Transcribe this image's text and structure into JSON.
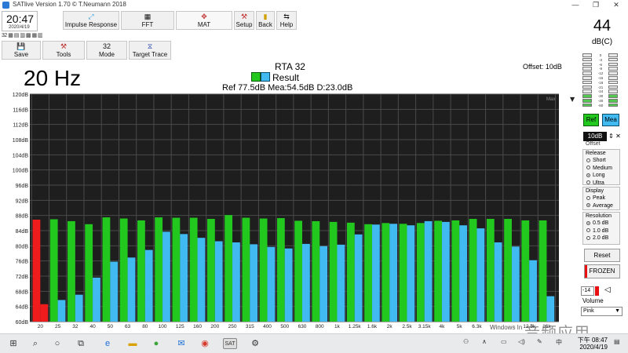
{
  "window": {
    "title": "SATlive Version 1.70 © T.Neumann 2018",
    "minimize": "—",
    "maximize": "❐",
    "close": "✕"
  },
  "clock": {
    "time": "20:47",
    "date": "2020/4/19"
  },
  "mini_icons": "32 ▦ ▤ ▥ ▩ ▦ ▥",
  "toolbar": {
    "impulse": "Impulse Response",
    "fft": "FFT",
    "mat": "MAT",
    "setup": "Setup",
    "back": "Back",
    "help": "Help",
    "save": "Save",
    "tools": "Tools",
    "mode": "Mode",
    "mode_icon": "32",
    "target_trace": "Target Trace"
  },
  "display": {
    "frequency": "20 Hz",
    "rta_title": "RTA 32",
    "legend": "Result",
    "stats": "Ref 77.5dB Mea:54.5dB D:23.0dB",
    "offset_label": "Offset: 10dB",
    "max_tag": "Max"
  },
  "side": {
    "spl_value": "44",
    "spl_unit": "dB(C)",
    "meter_scale": [
      "0",
      "-3",
      "-6",
      "-9",
      "-12",
      "-15",
      "-18",
      "-21",
      "-24",
      "-30",
      "-40",
      "-60"
    ],
    "ref_label": "Ref",
    "mea_label": "Mea",
    "offset_value": "10dB",
    "offset_caption": "Offset",
    "release": {
      "title": "Release",
      "options": [
        "Short",
        "Medium",
        "Long",
        "Ultra"
      ],
      "selected": 2
    },
    "display_group": {
      "title": "Display",
      "options": [
        "Peak",
        "Average"
      ],
      "selected": 1
    },
    "resolution": {
      "title": "Resolution",
      "options": [
        "0.5 dB",
        "1.0 dB",
        "2.0 dB"
      ],
      "selected": 0
    },
    "reset": "Reset",
    "frozen": "FROZEN",
    "volume_value": "-14",
    "volume_label": "Volume",
    "noise_type": "Pink"
  },
  "chart_data": {
    "type": "bar",
    "title": "RTA 32",
    "xlabel": "",
    "ylabel": "",
    "ylim": [
      60,
      120
    ],
    "y_ticks": [
      "60dB",
      "64dB",
      "68dB",
      "72dB",
      "76dB",
      "80dB",
      "84dB",
      "88dB",
      "92dB",
      "96dB",
      "100dB",
      "104dB",
      "108dB",
      "112dB",
      "116dB",
      "120dB"
    ],
    "categories": [
      "20",
      "25",
      "32",
      "40",
      "50",
      "63",
      "80",
      "100",
      "125",
      "160",
      "200",
      "250",
      "315",
      "400",
      "500",
      "630",
      "800",
      "1k",
      "1.25k",
      "1.6k",
      "2k",
      "2.5k",
      "3.15k",
      "4k",
      "5k",
      "6.3k",
      "8k",
      "10k",
      "12.5k",
      "16k"
    ],
    "grid": true,
    "colors": {
      "ref": "#22c81e",
      "mea": "#41baf2",
      "highlight": "#ee1c1c",
      "background": "#1e1e1e",
      "grid": "#4a4a4a"
    },
    "highlight_index": 0,
    "series": [
      {
        "name": "Ref",
        "values": [
          86.9,
          87,
          86.5,
          85.7,
          87.5,
          87.2,
          86.7,
          87.5,
          87.4,
          87.4,
          87.1,
          88.1,
          87.4,
          87.2,
          87.3,
          86.6,
          86.5,
          86.3,
          86.1,
          85.7,
          86,
          85.8,
          86,
          86.6,
          86.7,
          87.1,
          87.1,
          87.1,
          86.7,
          86.7
        ]
      },
      {
        "name": "Mea",
        "values": [
          64.6,
          65.7,
          67.1,
          71.6,
          75.8,
          76.9,
          78.9,
          83.7,
          83.1,
          82.1,
          81.2,
          80.9,
          80.4,
          79.7,
          79.3,
          80.5,
          79.9,
          80.3,
          83,
          85.6,
          85.8,
          85.4,
          86.5,
          86.3,
          85.4,
          84.6,
          80.9,
          79.8,
          76.2,
          66.7
        ]
      }
    ]
  },
  "taskbar": {
    "time": "下午 08:47",
    "date": "2020/4/19",
    "sat_label": "SAT",
    "lang": "中"
  },
  "watermark": "Windows In",
  "corner_logo": "音频应用"
}
